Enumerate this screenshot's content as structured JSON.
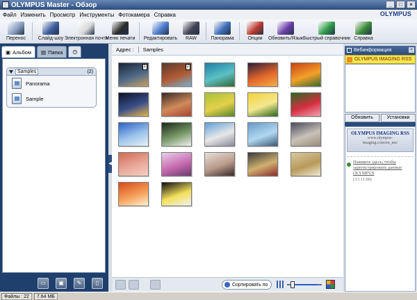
{
  "window": {
    "title_app": "OLYMPUS Master",
    "title_view": "- Обзор",
    "controls": [
      "_",
      "□",
      "×"
    ]
  },
  "menu": {
    "items": [
      "Файл",
      "Изменить",
      "Просмотр",
      "Инструменты",
      "Фотокамера",
      "Справка"
    ],
    "brand": "OLYMPUS"
  },
  "toolbar": {
    "items": [
      {
        "label": "Перенос",
        "icon": "camera-transfer-icon",
        "color": "#8aa0c2"
      },
      {
        "label": "Слайд-шоу",
        "icon": "slideshow-icon",
        "color": "#3f5f9d"
      },
      {
        "label": "Электронная почта",
        "icon": "email-icon",
        "color": "#d9d9d9"
      },
      {
        "label": "Меню печати",
        "icon": "printer-icon",
        "color": "#2b2b2b"
      },
      {
        "label": "Редактировать",
        "icon": "edit-image-icon",
        "color": "#4d7ccc"
      },
      {
        "label": "RAW",
        "icon": "raw-icon",
        "color": "#445"
      },
      {
        "label": "Панорама",
        "icon": "panorama-icon",
        "color": "#3f6fb8"
      },
      {
        "label": "Опции",
        "icon": "options-icon",
        "color": "#b83a2f"
      },
      {
        "label": "Обновить/Язык",
        "icon": "update-language-icon",
        "color": "#6a3fa8"
      },
      {
        "label": "Быстрый справочник",
        "icon": "quick-guide-icon",
        "color": "#2f9a4a"
      },
      {
        "label": "Справка",
        "icon": "help-icon",
        "color": "#3a8a3a"
      }
    ]
  },
  "left": {
    "tabs": [
      {
        "label": "Альбом",
        "icon": "album-tab-icon"
      },
      {
        "label": "Папка",
        "icon": "folder-tab-icon"
      }
    ],
    "clock_icon": "calendar-clock-icon",
    "group": {
      "title": "Samples",
      "count": "(2)"
    },
    "albums": [
      {
        "label": "Panorama"
      },
      {
        "label": "Sample"
      }
    ],
    "bottom_icons": [
      "new-album-icon",
      "import-icon",
      "edit-album-icon",
      "delete-album-icon"
    ]
  },
  "address": {
    "label": "Адрес :",
    "value": "Samples"
  },
  "thumbnails": [
    {
      "colors": [
        "#1b2333",
        "#4e6b8a",
        "#c9a062"
      ],
      "badge": "1"
    },
    {
      "colors": [
        "#5a3a2c",
        "#b05a33",
        "#7ab0d0"
      ],
      "badge": "2"
    },
    {
      "colors": [
        "#1f7fa6",
        "#5cc0c4",
        "#2e6a3a"
      ]
    },
    {
      "colors": [
        "#2d1f3d",
        "#e0652a",
        "#f8b048"
      ]
    },
    {
      "colors": [
        "#c84212",
        "#f4a02a",
        "#3a6a2a"
      ]
    },
    {
      "colors": [
        "#0c1226",
        "#3a4f8a",
        "#e6b24a"
      ]
    },
    {
      "colors": [
        "#3a2a26",
        "#d08a5a",
        "#a8452f"
      ]
    },
    {
      "colors": [
        "#a8c236",
        "#e4d04a",
        "#5a8a2a"
      ]
    },
    {
      "colors": [
        "#f2d23a",
        "#f4e890",
        "#2a6a1a"
      ]
    },
    {
      "colors": [
        "#2a6a22",
        "#d42e3e",
        "#f0a0b0"
      ]
    },
    {
      "colors": [
        "#2c62c6",
        "#9cc4ec",
        "#e8f0f8"
      ]
    },
    {
      "colors": [
        "#1a2a1a",
        "#7a9a6a",
        "#f0f0f0"
      ]
    },
    {
      "colors": [
        "#5fa0d8",
        "#e8e8e8",
        "#8a8a9a"
      ]
    },
    {
      "colors": [
        "#6a9ac8",
        "#b0d8f0",
        "#3a5a7a"
      ]
    },
    {
      "colors": [
        "#4a4c5e",
        "#c9c2b8",
        "#9a8b7a"
      ]
    },
    {
      "colors": [
        "#d06a52",
        "#e8a89a",
        "#f2d0c0"
      ]
    },
    {
      "colors": [
        "#e8d0e8",
        "#c86ab0",
        "#6a3a6a"
      ]
    },
    {
      "colors": [
        "#e8e0d8",
        "#b89a8a",
        "#3a2a2a"
      ]
    },
    {
      "colors": [
        "#3a3a3a",
        "#d0b070",
        "#8a2a2a"
      ]
    },
    {
      "colors": [
        "#d8c8a0",
        "#b89a5a",
        "#f0e8d0"
      ]
    },
    {
      "colors": [
        "#d84a1a",
        "#f4a05a",
        "#fff0d0"
      ]
    },
    {
      "colors": [
        "#0e0c12",
        "#f2e05a",
        "#f0f0f0"
      ]
    }
  ],
  "bottom_bar": {
    "sort_label": "Сортировать по",
    "icons": [
      "rotate-left-icon",
      "rotate-right-icon",
      "add-to-album-icon",
      "thumbnail-grid-icon",
      "large-view-icon"
    ],
    "zoom_level": 0.12
  },
  "right": {
    "header": "Вебинформация",
    "rss_label": "OLYMPUS IMAGING RSS",
    "buttons": [
      "Обновить",
      "Установки"
    ],
    "news_title": "OLYMPUS IMAGING RSS",
    "news_sub1": "www.olympus-",
    "news_sub2": "imaging.com/en_ms/",
    "news_text": "Нажмите здесь, чтобы зарегистрировать данные OLYMPUS",
    "news_date": "(3/1 11:00)"
  },
  "status": {
    "files": "Файлы : 22",
    "size": "7.64 МБ"
  }
}
